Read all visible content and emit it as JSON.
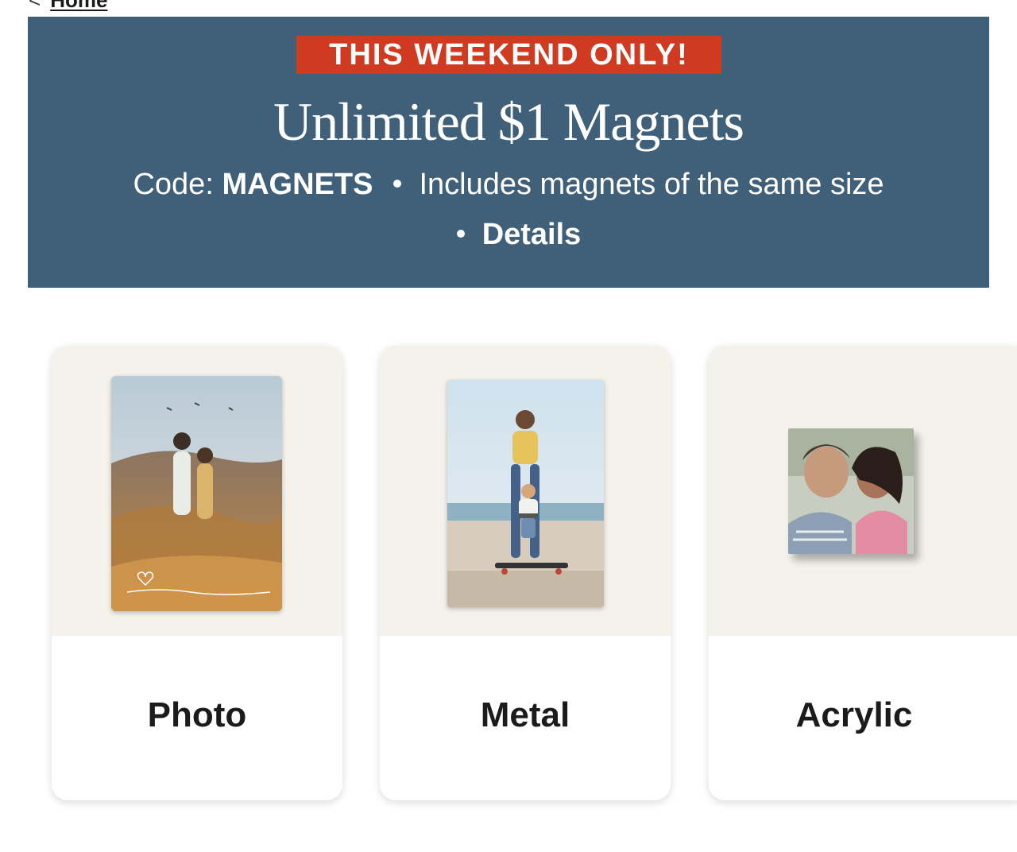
{
  "breadcrumb": {
    "back_icon": "chevron-left-icon",
    "home_label": "Home"
  },
  "banner": {
    "badge": "THIS WEEKEND ONLY!",
    "headline": "Unlimited $1 Magnets",
    "code_prefix": "Code: ",
    "code_value": "MAGNETS",
    "description": "Includes magnets of the same size",
    "details_label": "Details",
    "colors": {
      "background": "#405f78",
      "badge": "#cf3a20"
    }
  },
  "cards": [
    {
      "label": "Photo",
      "image": "kids-on-rocks-photo-magnet"
    },
    {
      "label": "Metal",
      "image": "mother-child-skateboard-metal-magnet"
    },
    {
      "label": "Acrylic",
      "image": "grandmother-girl-acrylic-magnet"
    }
  ]
}
